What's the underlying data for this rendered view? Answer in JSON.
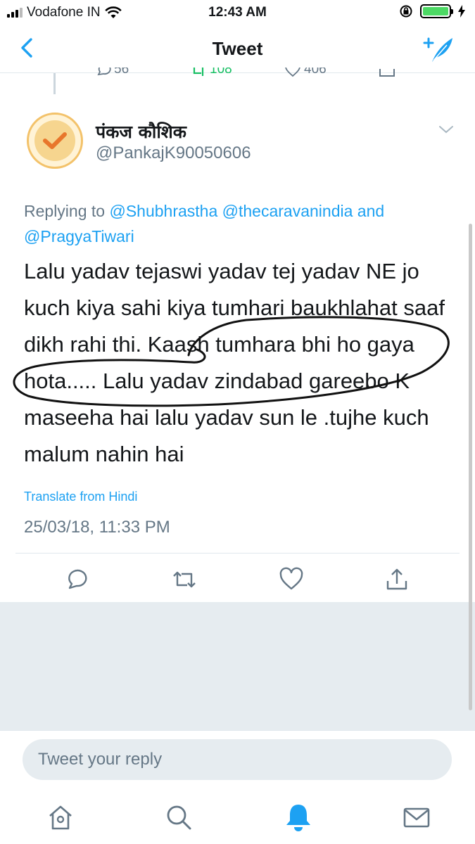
{
  "status_bar": {
    "carrier": "Vodafone IN",
    "time": "12:43 AM",
    "battery_color": "#4cd964"
  },
  "nav": {
    "title": "Tweet",
    "back_icon": "chevron-left-icon",
    "compose_icon": "compose-feather-icon",
    "accent": "#1da1f2"
  },
  "prev_tweet_actions": {
    "replies": "56",
    "retweets": "108",
    "likes": "406"
  },
  "tweet": {
    "display_name": "पंकज कौशिक",
    "handle": "@PankajK90050606",
    "replying_prefix": "Replying to",
    "mentions": [
      "@Shubhrastha",
      "@thecaravanindia"
    ],
    "mentions_joiner": "and",
    "mention_last": "@PragyaTiwari",
    "text": "Lalu yadav tejaswi yadav tej yadav NE jo kuch kiya sahi kiya tumhari baukhlahat saaf dikh rahi thi. Kaash tumhara bhi ho gaya hota.....  Lalu yadav zindabad gareebo K maseeha hai lalu yadav sun le .tujhe kuch malum nahin hai",
    "translate_label": "Translate from Hindi",
    "timestamp": "25/03/18, 11:33 PM"
  },
  "reply": {
    "placeholder": "Tweet your reply"
  },
  "tabbar": {
    "items": [
      "home-icon",
      "search-icon",
      "notifications-bell-icon",
      "messages-mail-icon"
    ],
    "active_color": "#1da1f2"
  }
}
